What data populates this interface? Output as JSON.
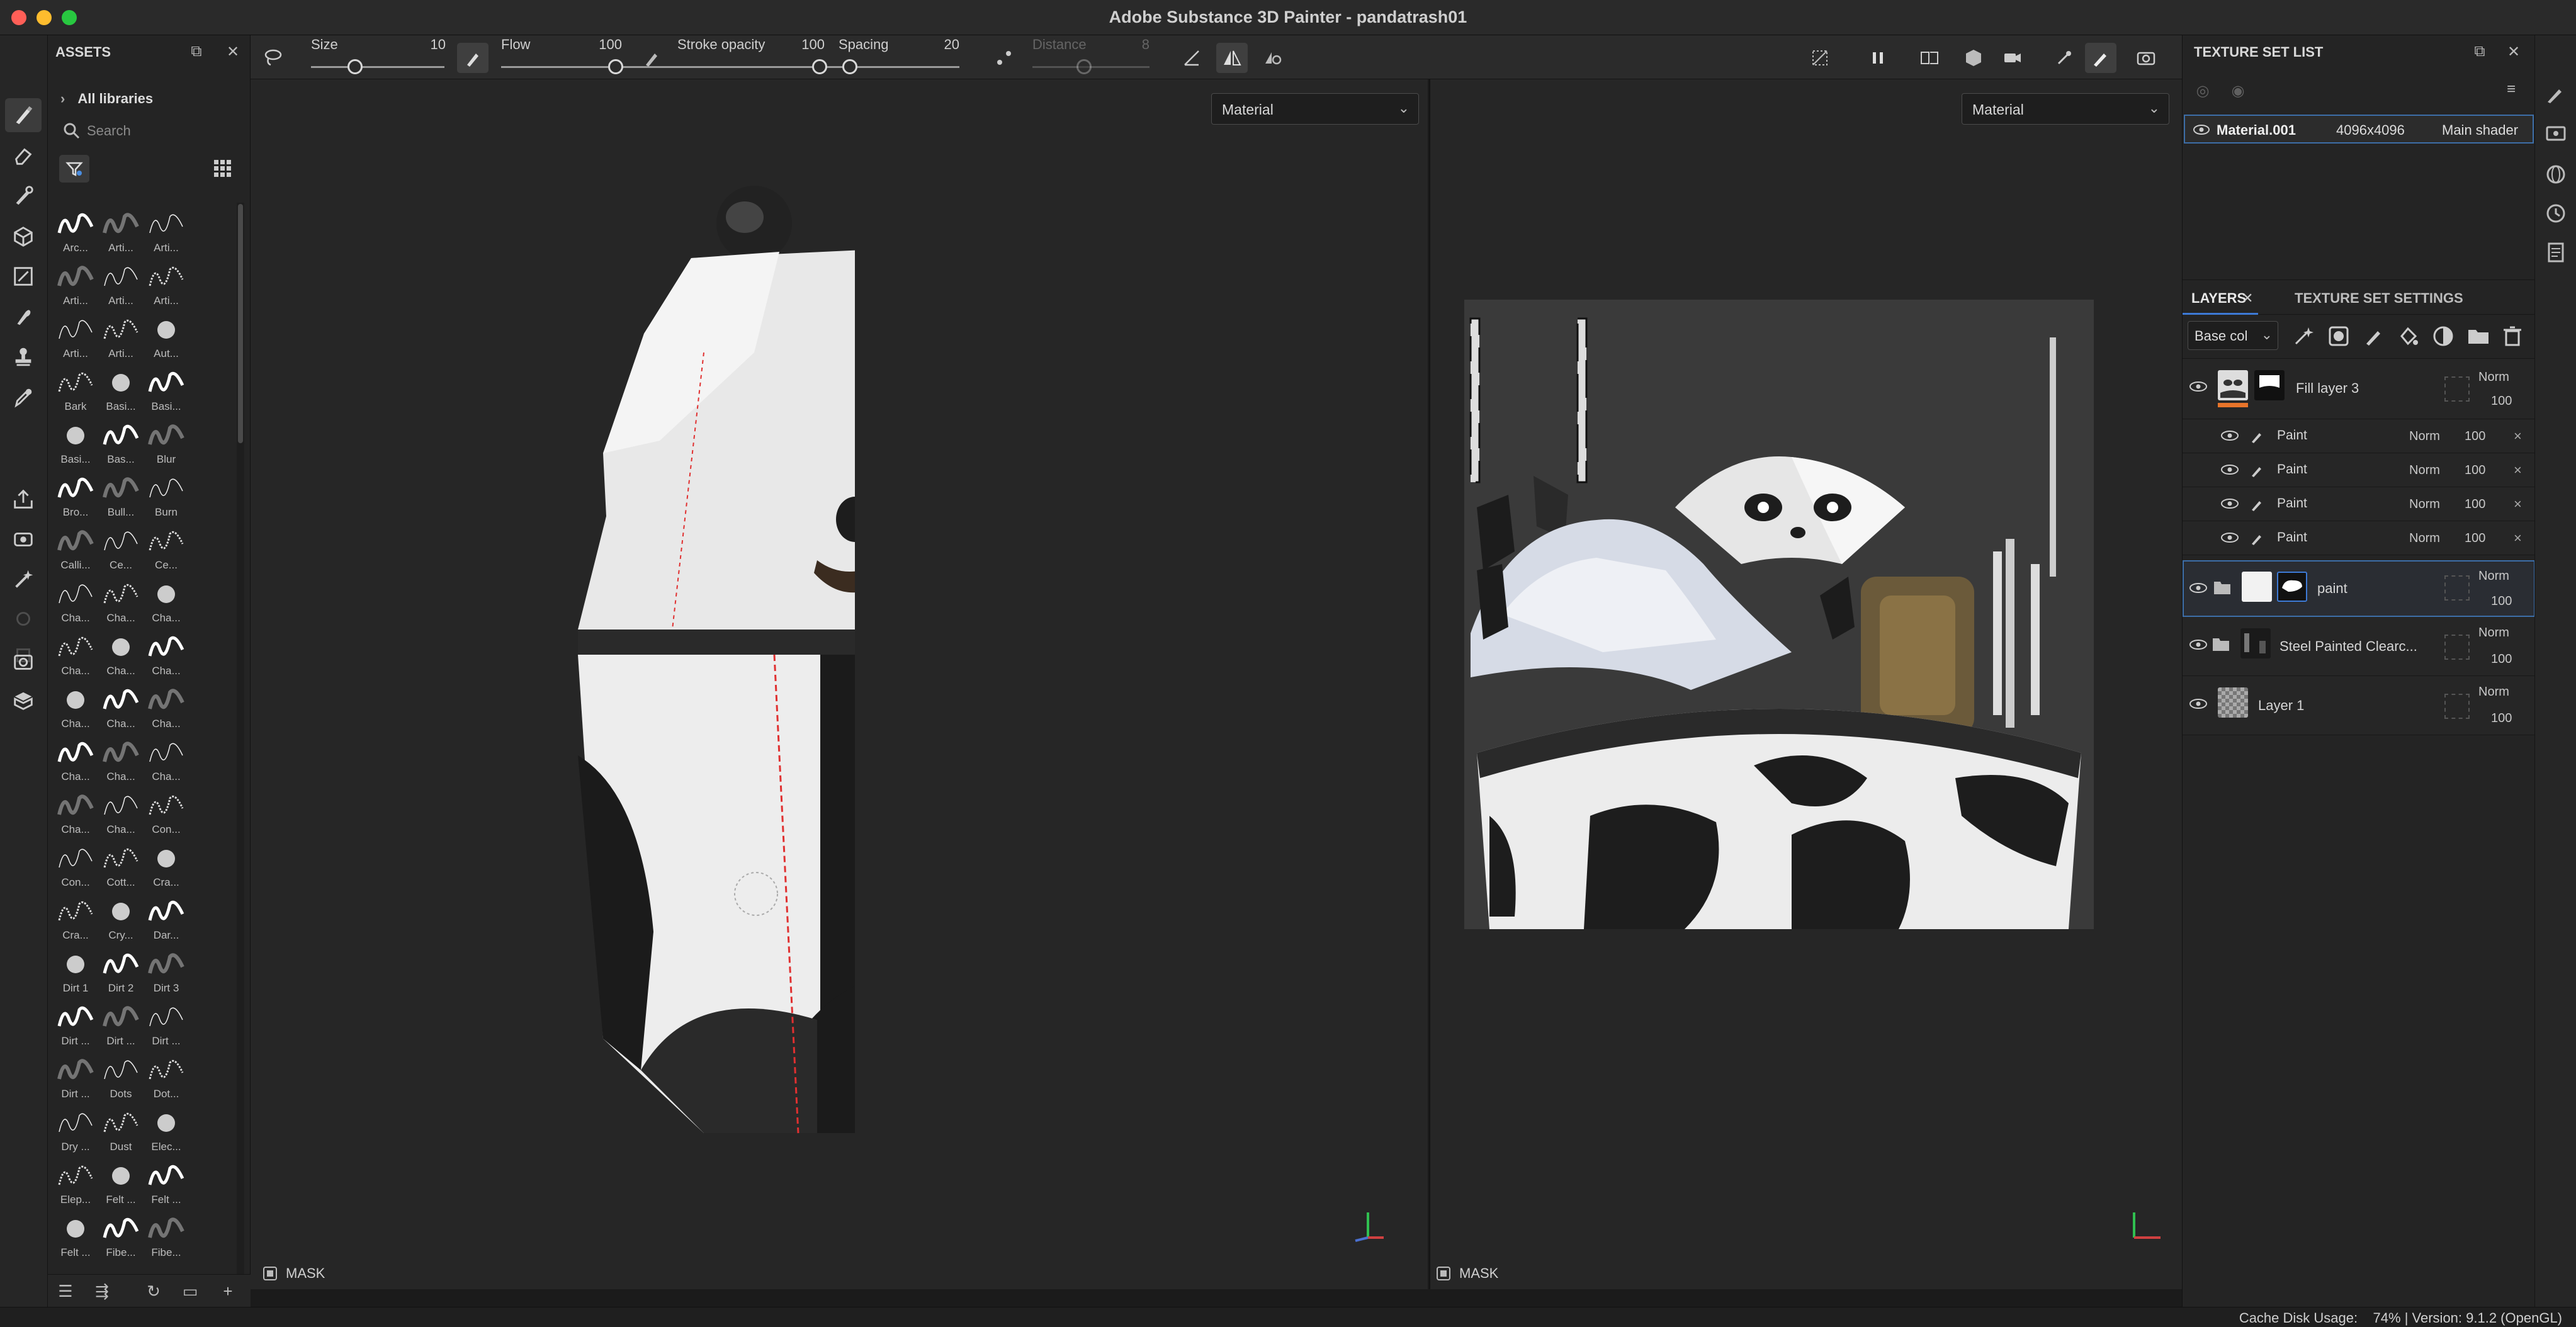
{
  "window": {
    "title": "Adobe Substance 3D Painter - pandatrash01"
  },
  "assets": {
    "title": "ASSETS",
    "library": "All libraries",
    "search_placeholder": "Search",
    "brushes": [
      "Arc...",
      "Arti...",
      "Arti...",
      "Arti...",
      "Arti...",
      "Arti...",
      "Arti...",
      "Arti...",
      "Aut...",
      "Bark",
      "Basi...",
      "Basi...",
      "Basi...",
      "Bas...",
      "Blur",
      "Bro...",
      "Bull...",
      "Burn",
      "Calli...",
      "Ce...",
      "Ce...",
      "Cha...",
      "Cha...",
      "Cha...",
      "Cha...",
      "Cha...",
      "Cha...",
      "Cha...",
      "Cha...",
      "Cha...",
      "Cha...",
      "Cha...",
      "Cha...",
      "Cha...",
      "Cha...",
      "Con...",
      "Con...",
      "Cott...",
      "Cra...",
      "Cra...",
      "Cry...",
      "Dar...",
      "Dirt 1",
      "Dirt 2",
      "Dirt 3",
      "Dirt ...",
      "Dirt ...",
      "Dirt ...",
      "Dirt ...",
      "Dots",
      "Dot...",
      "Dry ...",
      "Dust",
      "Elec...",
      "Elep...",
      "Felt ...",
      "Felt ...",
      "Felt ...",
      "Fibe...",
      "Fibe..."
    ]
  },
  "toolbar": {
    "size": {
      "label": "Size",
      "value": "10"
    },
    "flow": {
      "label": "Flow",
      "value": "100"
    },
    "stroke_opacity": {
      "label": "Stroke opacity",
      "value": "100"
    },
    "spacing": {
      "label": "Spacing",
      "value": "20"
    },
    "distance": {
      "label": "Distance",
      "value": "8"
    }
  },
  "viewport3d": {
    "mode": "Material",
    "mask_label": "MASK"
  },
  "viewport2d": {
    "mode": "Material",
    "mask_label": "MASK"
  },
  "texture_set_list": {
    "title": "TEXTURE SET LIST",
    "row": {
      "name": "Material.001",
      "resolution": "4096x4096",
      "shader": "Main shader"
    }
  },
  "layers_panel": {
    "tab_layers": "LAYERS",
    "tab_settings": "TEXTURE SET SETTINGS",
    "channel": "Base col",
    "layers": [
      {
        "name": "Fill layer 3",
        "blend": "Norm",
        "opacity": "100"
      },
      {
        "name": "Paint",
        "blend": "Norm",
        "opacity": "100"
      },
      {
        "name": "Paint",
        "blend": "Norm",
        "opacity": "100"
      },
      {
        "name": "Paint",
        "blend": "Norm",
        "opacity": "100"
      },
      {
        "name": "Paint",
        "blend": "Norm",
        "opacity": "100"
      },
      {
        "name": "paint",
        "blend": "Norm",
        "opacity": "100"
      },
      {
        "name": "Steel Painted Clearc...",
        "blend": "Norm",
        "opacity": "100"
      },
      {
        "name": "Layer 1",
        "blend": "Norm",
        "opacity": "100"
      }
    ]
  },
  "status": {
    "text": "Cache Disk Usage:    74% | Version: 9.1.2 (OpenGL)"
  },
  "colors": {
    "accent": "#3d7ad6",
    "fill_tag": "#e8742a"
  }
}
